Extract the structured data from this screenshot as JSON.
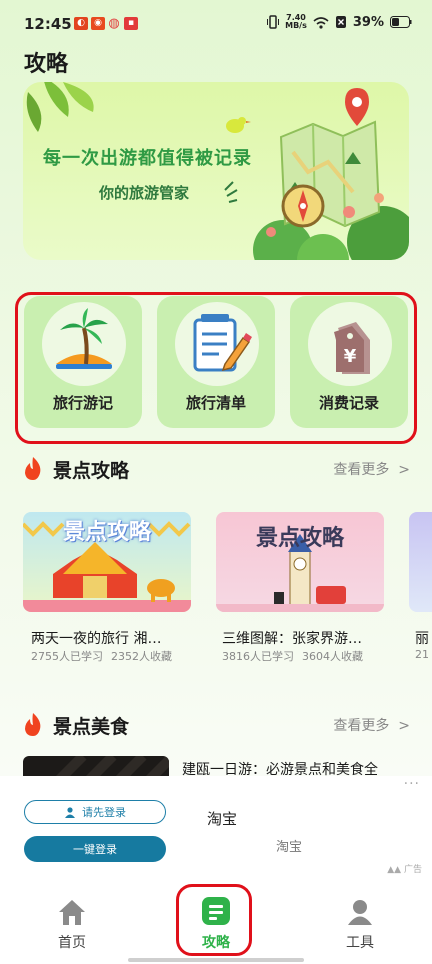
{
  "status_bar": {
    "time": "12:45",
    "speed_value": "7.40",
    "speed_unit": "MB/s",
    "battery": "39%"
  },
  "page": {
    "title": "攻略"
  },
  "banner": {
    "headline": "每一次出游都值得被记录",
    "subline": "你的旅游管家"
  },
  "quick_entries": [
    {
      "label": "旅行游记",
      "icon": "palm-island-icon"
    },
    {
      "label": "旅行清单",
      "icon": "checklist-pencil-icon"
    },
    {
      "label": "消费记录",
      "icon": "yen-price-tag-icon"
    }
  ],
  "scenic_section": {
    "title": "景点攻略",
    "more": "查看更多",
    "cards": [
      {
        "badge": "景点攻略",
        "title": "两天一夜的旅行 湘…",
        "learned": "2755人已学习",
        "saved": "2352人收藏"
      },
      {
        "badge": "景点攻略",
        "title": "三维图解：张家界游…",
        "learned": "3816人已学习",
        "saved": "3604人收藏"
      },
      {
        "title": "丽",
        "learned": "21"
      }
    ]
  },
  "food_section": {
    "title": "景点美食",
    "more": "查看更多",
    "items": [
      {
        "title": "建瓯一日游：必游景点和美食全"
      }
    ]
  },
  "ad": {
    "login_label": "请先登录",
    "oneclick_label": "一键登录",
    "app_name": "淘宝",
    "app_sub": "淘宝",
    "ad_tag": "广告"
  },
  "bottom_nav": [
    {
      "label": "首页",
      "icon": "home-icon",
      "active": false
    },
    {
      "label": "攻略",
      "icon": "guide-icon",
      "active": true
    },
    {
      "label": "工具",
      "icon": "person-icon",
      "active": false
    }
  ],
  "colors": {
    "accent_green": "#2fb24a",
    "highlight_red": "#e0101a",
    "card_green": "#c9efb0"
  }
}
